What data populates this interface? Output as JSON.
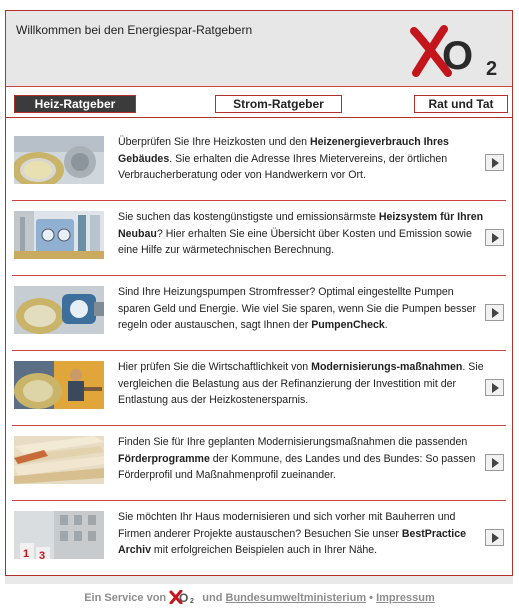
{
  "header": {
    "title": "Willkommen bei den Energiespar-Ratgebern",
    "logo_text": "O",
    "logo_sub": "2"
  },
  "tabs": [
    {
      "label": "Heiz-Ratgeber",
      "active": true
    },
    {
      "label": "Strom-Ratgeber",
      "active": false
    },
    {
      "label": "Rat und Tat",
      "active": false
    }
  ],
  "items": [
    {
      "parts": [
        {
          "t": "Überprüfen Sie Ihre Heizkosten und den ",
          "b": false
        },
        {
          "t": "Heizenergieverbrauch Ihres Gebäudes",
          "b": true
        },
        {
          "t": ". Sie erhalten die Adresse Ihres Mietervereins, der örtlichen Verbraucherberatung oder von Handwerkern vor Ort.",
          "b": false
        }
      ],
      "thumb_icon": "coin-thermostat-image"
    },
    {
      "parts": [
        {
          "t": "Sie suchen das kostengünstigste und emissionsärmste ",
          "b": false
        },
        {
          "t": "Heizsystem für Ihren Neubau",
          "b": true
        },
        {
          "t": "? Hier erhalten Sie eine Übersicht über Kosten und Emission sowie eine Hilfe zur wärmetechnischen Berechnung.",
          "b": false
        }
      ],
      "thumb_icon": "heating-system-image"
    },
    {
      "parts": [
        {
          "t": "Sind Ihre Heizungspumpen Stromfresser? Optimal eingestellte Pumpen sparen Geld und Energie. Wie viel Sie sparen, wenn Sie die Pumpen besser regeln oder austauschen, sagt Ihnen der ",
          "b": false
        },
        {
          "t": "PumpenCheck",
          "b": true
        },
        {
          "t": ".",
          "b": false
        }
      ],
      "thumb_icon": "coin-pump-image"
    },
    {
      "parts": [
        {
          "t": "Hier prüfen Sie die Wirtschaftlichkeit von ",
          "b": false
        },
        {
          "t": "Modernisierungs-maßnahmen",
          "b": true
        },
        {
          "t": ". Sie vergleichen die Belastung aus der Refinanzierung der Investition mit der Entlastung aus der Heizkostenersparnis.",
          "b": false
        }
      ],
      "thumb_icon": "coin-worker-image"
    },
    {
      "parts": [
        {
          "t": "Finden Sie für Ihre geplanten Modernisierungsmaßnahmen die passenden ",
          "b": false
        },
        {
          "t": "Förderprogramme",
          "b": true
        },
        {
          "t": " der Kommune, des Landes und des Bundes: So passen Förderprofil und Maßnahmenprofil zueinander.",
          "b": false
        }
      ],
      "thumb_icon": "documents-image"
    },
    {
      "parts": [
        {
          "t": "Sie möchten Ihr Haus modernisieren und sich vorher mit Bauherren und Firmen anderer Projekte austauschen? Besuchen Sie unser ",
          "b": false
        },
        {
          "t": "BestPractice Archiv",
          "b": true
        },
        {
          "t": " mit erfolgreichen Beispielen auch in Ihrer Nähe.",
          "b": false
        }
      ],
      "thumb_icon": "building-podium-image",
      "thumb_numbers": [
        "1",
        "3"
      ]
    }
  ],
  "footer": {
    "prefix": "Ein Service von",
    "logo_text": "O",
    "logo_sub": "2",
    "and": "und",
    "ministry_link": "Bundesumweltministerium",
    "separator": "•",
    "impressum_link": "Impressum"
  },
  "colors": {
    "accent_red": "#b3312b",
    "header_gray": "#e7e7e7",
    "tab_active_bg": "#3b3b3b"
  }
}
